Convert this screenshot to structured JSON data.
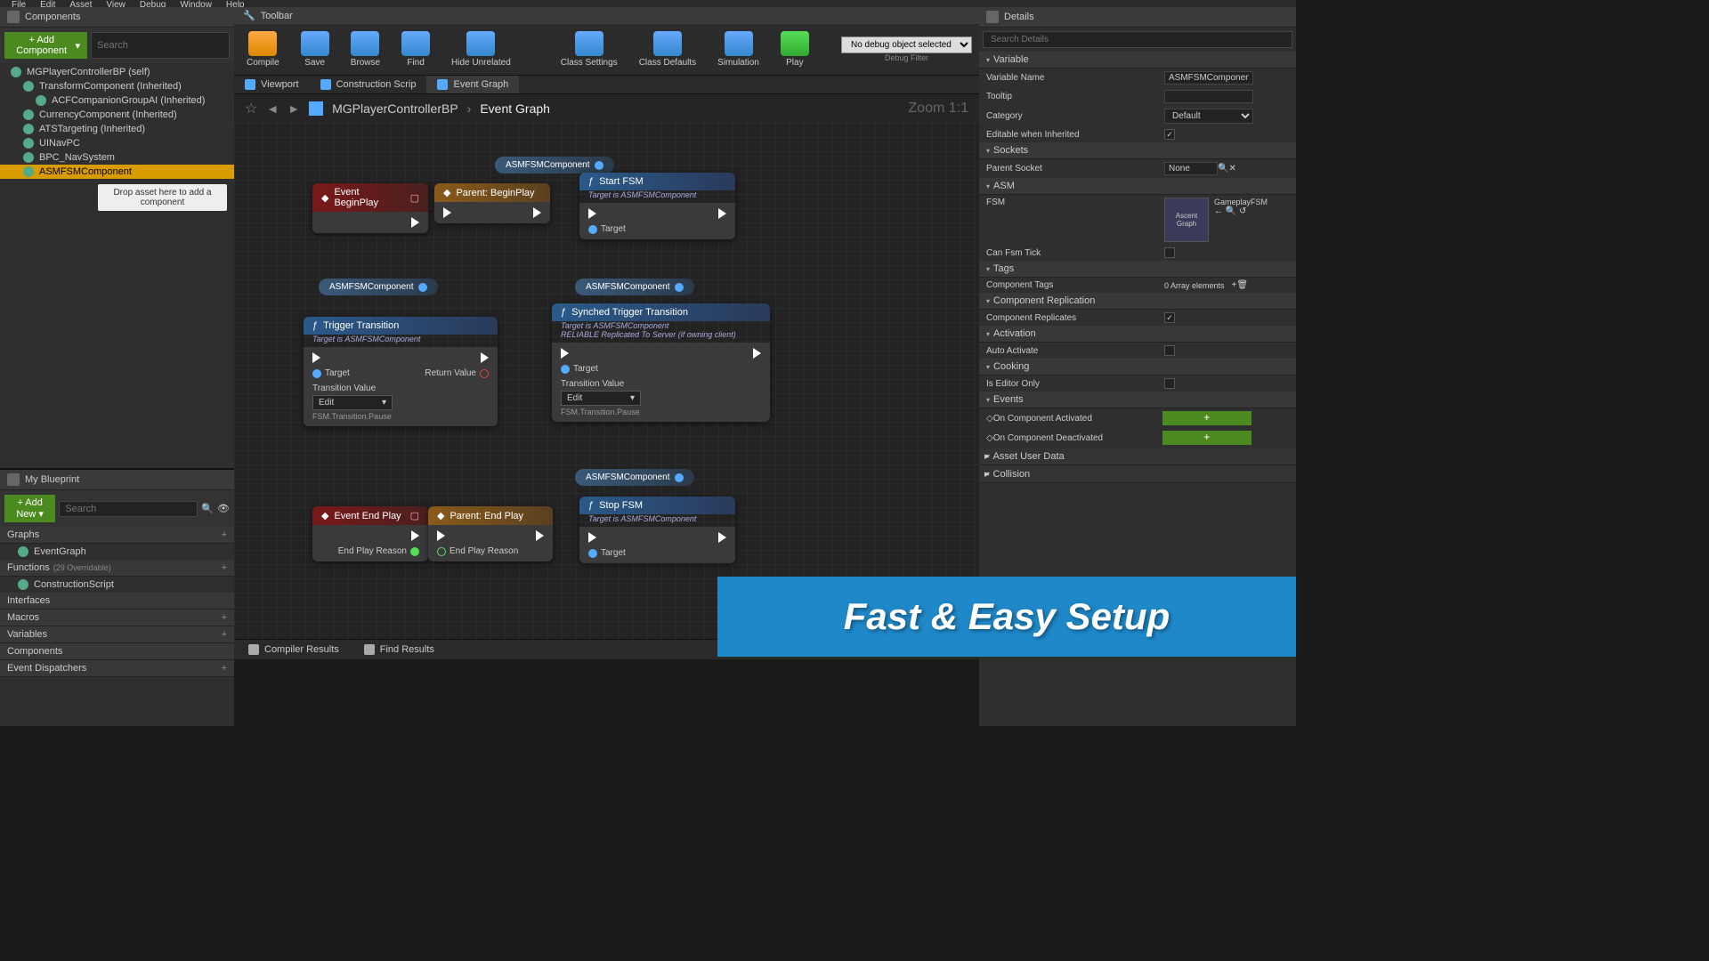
{
  "menu": [
    "File",
    "Edit",
    "Asset",
    "View",
    "Debug",
    "Window",
    "Help"
  ],
  "panels": {
    "components": "Components",
    "toolbar": "Toolbar",
    "details": "Details",
    "myblueprint": "My Blueprint"
  },
  "addComponent": "+ Add Component",
  "searchPlaceholder": "Search",
  "compTree": [
    {
      "label": "MGPlayerControllerBP (self)",
      "d": 0
    },
    {
      "label": "TransformComponent (Inherited)",
      "d": 1
    },
    {
      "label": "ACFCompanionGroupAI (Inherited)",
      "d": 2
    },
    {
      "label": "CurrencyComponent (Inherited)",
      "d": 1
    },
    {
      "label": "ATSTargeting (Inherited)",
      "d": 1
    },
    {
      "label": "UINavPC",
      "d": 1
    },
    {
      "label": "BPC_NavSystem",
      "d": 1
    },
    {
      "label": "ASMFSMComponent",
      "d": 1,
      "sel": true
    }
  ],
  "dropHint": "Drop asset here to add a component",
  "addNew": "+ Add New",
  "bpSections": {
    "graphs": "Graphs",
    "eventGraph": "EventGraph",
    "functions": "Functions",
    "overridable": "(29 Overridable)",
    "construction": "ConstructionScript",
    "interfaces": "Interfaces",
    "macros": "Macros",
    "variables": "Variables",
    "components": "Components",
    "dispatchers": "Event Dispatchers"
  },
  "toolbarBtns": {
    "compile": "Compile",
    "save": "Save",
    "browse": "Browse",
    "find": "Find",
    "hide": "Hide Unrelated",
    "settings": "Class Settings",
    "defaults": "Class Defaults",
    "sim": "Simulation",
    "play": "Play"
  },
  "debugObj": "No debug object selected",
  "debugFilter": "Debug Filter",
  "subtabs": {
    "viewport": "Viewport",
    "construction": "Construction Scrip",
    "eventgraph": "Event Graph"
  },
  "breadcrumb": {
    "root": "MGPlayerControllerBP",
    "leaf": "Event Graph"
  },
  "zoom": "Zoom 1:1",
  "nodes": {
    "asmComp": "ASMFSMComponent",
    "beginPlay": "Event BeginPlay",
    "parentBegin": "Parent: BeginPlay",
    "startFSM": "Start FSM",
    "targetIs": "Target is ASMFSMComponent",
    "target": "Target",
    "returnValue": "Return Value",
    "triggerTrans": "Trigger Transition",
    "synchedTrigger": "Synched Trigger Transition",
    "reliable": "RELIABLE Replicated To Server (if owning client)",
    "transValue": "Transition Value",
    "edit": "Edit",
    "fsmPause": "FSM.Transition.Pause",
    "endPlay": "Event End Play",
    "parentEnd": "Parent: End Play",
    "endReason": "End Play Reason",
    "stopFSM": "Stop FSM"
  },
  "bottomTabs": {
    "compiler": "Compiler Results",
    "find": "Find Results"
  },
  "details": {
    "searchPlaceholder": "Search Details",
    "variable": "Variable",
    "varName": "Variable Name",
    "varNameVal": "ASMFSMComponent",
    "tooltip": "Tooltip",
    "category": "Category",
    "categoryVal": "Default",
    "editable": "Editable when Inherited",
    "sockets": "Sockets",
    "parentSocket": "Parent Socket",
    "none": "None",
    "asm": "ASM",
    "fsm": "FSM",
    "ascentGraph": "Ascent Graph",
    "gameplayFSM": "GameplayFSM",
    "canTick": "Can Fsm Tick",
    "tags": "Tags",
    "compTags": "Component Tags",
    "arrayElem": "0 Array elements",
    "compRepl": "Component Replication",
    "replicates": "Component Replicates",
    "activation": "Activation",
    "autoActivate": "Auto Activate",
    "cooking": "Cooking",
    "editorOnly": "Is Editor Only",
    "events": "Events",
    "onActivated": "On Component Activated",
    "onDeactivated": "On Component Deactivated",
    "assetUser": "Asset User Data",
    "collision": "Collision"
  },
  "banner": "Fast & Easy Setup"
}
